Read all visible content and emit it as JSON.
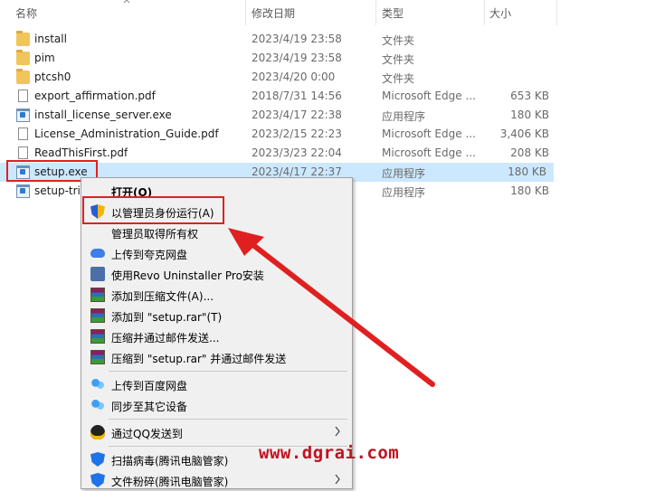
{
  "columns": {
    "name": "名称",
    "date": "修改日期",
    "type": "类型",
    "size": "大小"
  },
  "files": [
    {
      "name": "install",
      "date": "2023/4/19 23:58",
      "type": "文件夹",
      "size": "",
      "icon": "folder-icon"
    },
    {
      "name": "pim",
      "date": "2023/4/19 23:58",
      "type": "文件夹",
      "size": "",
      "icon": "folder-icon"
    },
    {
      "name": "ptcsh0",
      "date": "2023/4/20 0:00",
      "type": "文件夹",
      "size": "",
      "icon": "folder-icon"
    },
    {
      "name": "export_affirmation.pdf",
      "date": "2018/7/31 14:56",
      "type": "Microsoft Edge ...",
      "size": "653 KB",
      "icon": "pdf-document-icon"
    },
    {
      "name": "install_license_server.exe",
      "date": "2023/4/17 22:38",
      "type": "应用程序",
      "size": "180 KB",
      "icon": "application-icon"
    },
    {
      "name": "License_Administration_Guide.pdf",
      "date": "2023/2/15 22:23",
      "type": "Microsoft Edge ...",
      "size": "3,406 KB",
      "icon": "pdf-document-icon"
    },
    {
      "name": "ReadThisFirst.pdf",
      "date": "2023/3/23 22:04",
      "type": "Microsoft Edge ...",
      "size": "208 KB",
      "icon": "pdf-document-icon"
    },
    {
      "name": "setup.exe",
      "date": "2023/4/17 22:37",
      "type": "应用程序",
      "size": "180 KB",
      "icon": "application-icon",
      "selected": true
    },
    {
      "name": "setup-tri",
      "date": "",
      "type": "应用程序",
      "size": "180 KB",
      "icon": "application-icon"
    }
  ],
  "menu": {
    "open": "打开(O)",
    "run_as_admin": "以管理员身份运行(A)",
    "take_ownership": "管理员取得所有权",
    "upload_quark": "上传到夸克网盘",
    "revo": "使用Revo Uninstaller Pro安装",
    "add_archive": "添加到压缩文件(A)...",
    "add_rar": "添加到 \"setup.rar\"(T)",
    "compress_email": "压缩并通过邮件发送...",
    "compress_rar_email": "压缩到 \"setup.rar\" 并通过邮件发送",
    "upload_baidu": "上传到百度网盘",
    "sync_devices": "同步至其它设备",
    "send_qq": "通过QQ发送到",
    "scan_virus": "扫描病毒(腾讯电脑管家)",
    "shred_file": "文件粉碎(腾讯电脑管家)"
  },
  "watermark": "www.dgrai.com",
  "colors": {
    "selection": "#cce8ff",
    "highlight_red": "#e02020",
    "watermark": "#c1121f"
  }
}
